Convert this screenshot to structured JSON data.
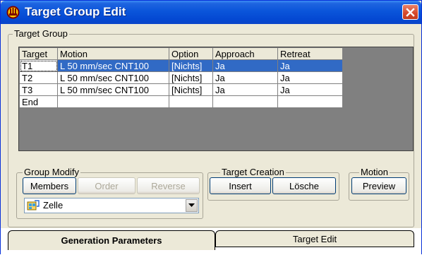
{
  "window": {
    "title": "Target Group Edit",
    "icons": {
      "title": "robot-app-icon",
      "close": "close-icon"
    }
  },
  "target_group": {
    "label": "Target Group",
    "columns": [
      "Target",
      "Motion",
      "Option",
      "Approach",
      "Retreat"
    ],
    "rows": [
      {
        "target": "T1",
        "motion": "L 50 mm/sec CNT100",
        "option": "[Nichts]",
        "approach": "Ja",
        "retreat": "Ja",
        "selected": true
      },
      {
        "target": "T2",
        "motion": "L 50 mm/sec CNT100",
        "option": "[Nichts]",
        "approach": "Ja",
        "retreat": "Ja",
        "selected": false
      },
      {
        "target": "T3",
        "motion": "L 50 mm/sec CNT100",
        "option": "[Nichts]",
        "approach": "Ja",
        "retreat": "Ja",
        "selected": false
      },
      {
        "target": "End",
        "motion": "",
        "option": "",
        "approach": "",
        "retreat": "",
        "selected": false
      }
    ]
  },
  "group_modify": {
    "label": "Group Modify",
    "members_label": "Members",
    "order_label": "Order",
    "reverse_label": "Reverse",
    "combo_value": "Zelle",
    "combo_icon": "cell-icon"
  },
  "target_creation": {
    "label": "Target Creation",
    "insert_label": "Insert",
    "delete_label": "Lösche"
  },
  "motion": {
    "label": "Motion",
    "preview_label": "Preview"
  },
  "tabs": {
    "generation": "Generation Parameters",
    "target_edit": "Target Edit"
  },
  "colors": {
    "title_bar": "#0a55da",
    "selection": "#316ac5",
    "window_bg": "#ece9d8",
    "close_button": "#d5472a"
  }
}
